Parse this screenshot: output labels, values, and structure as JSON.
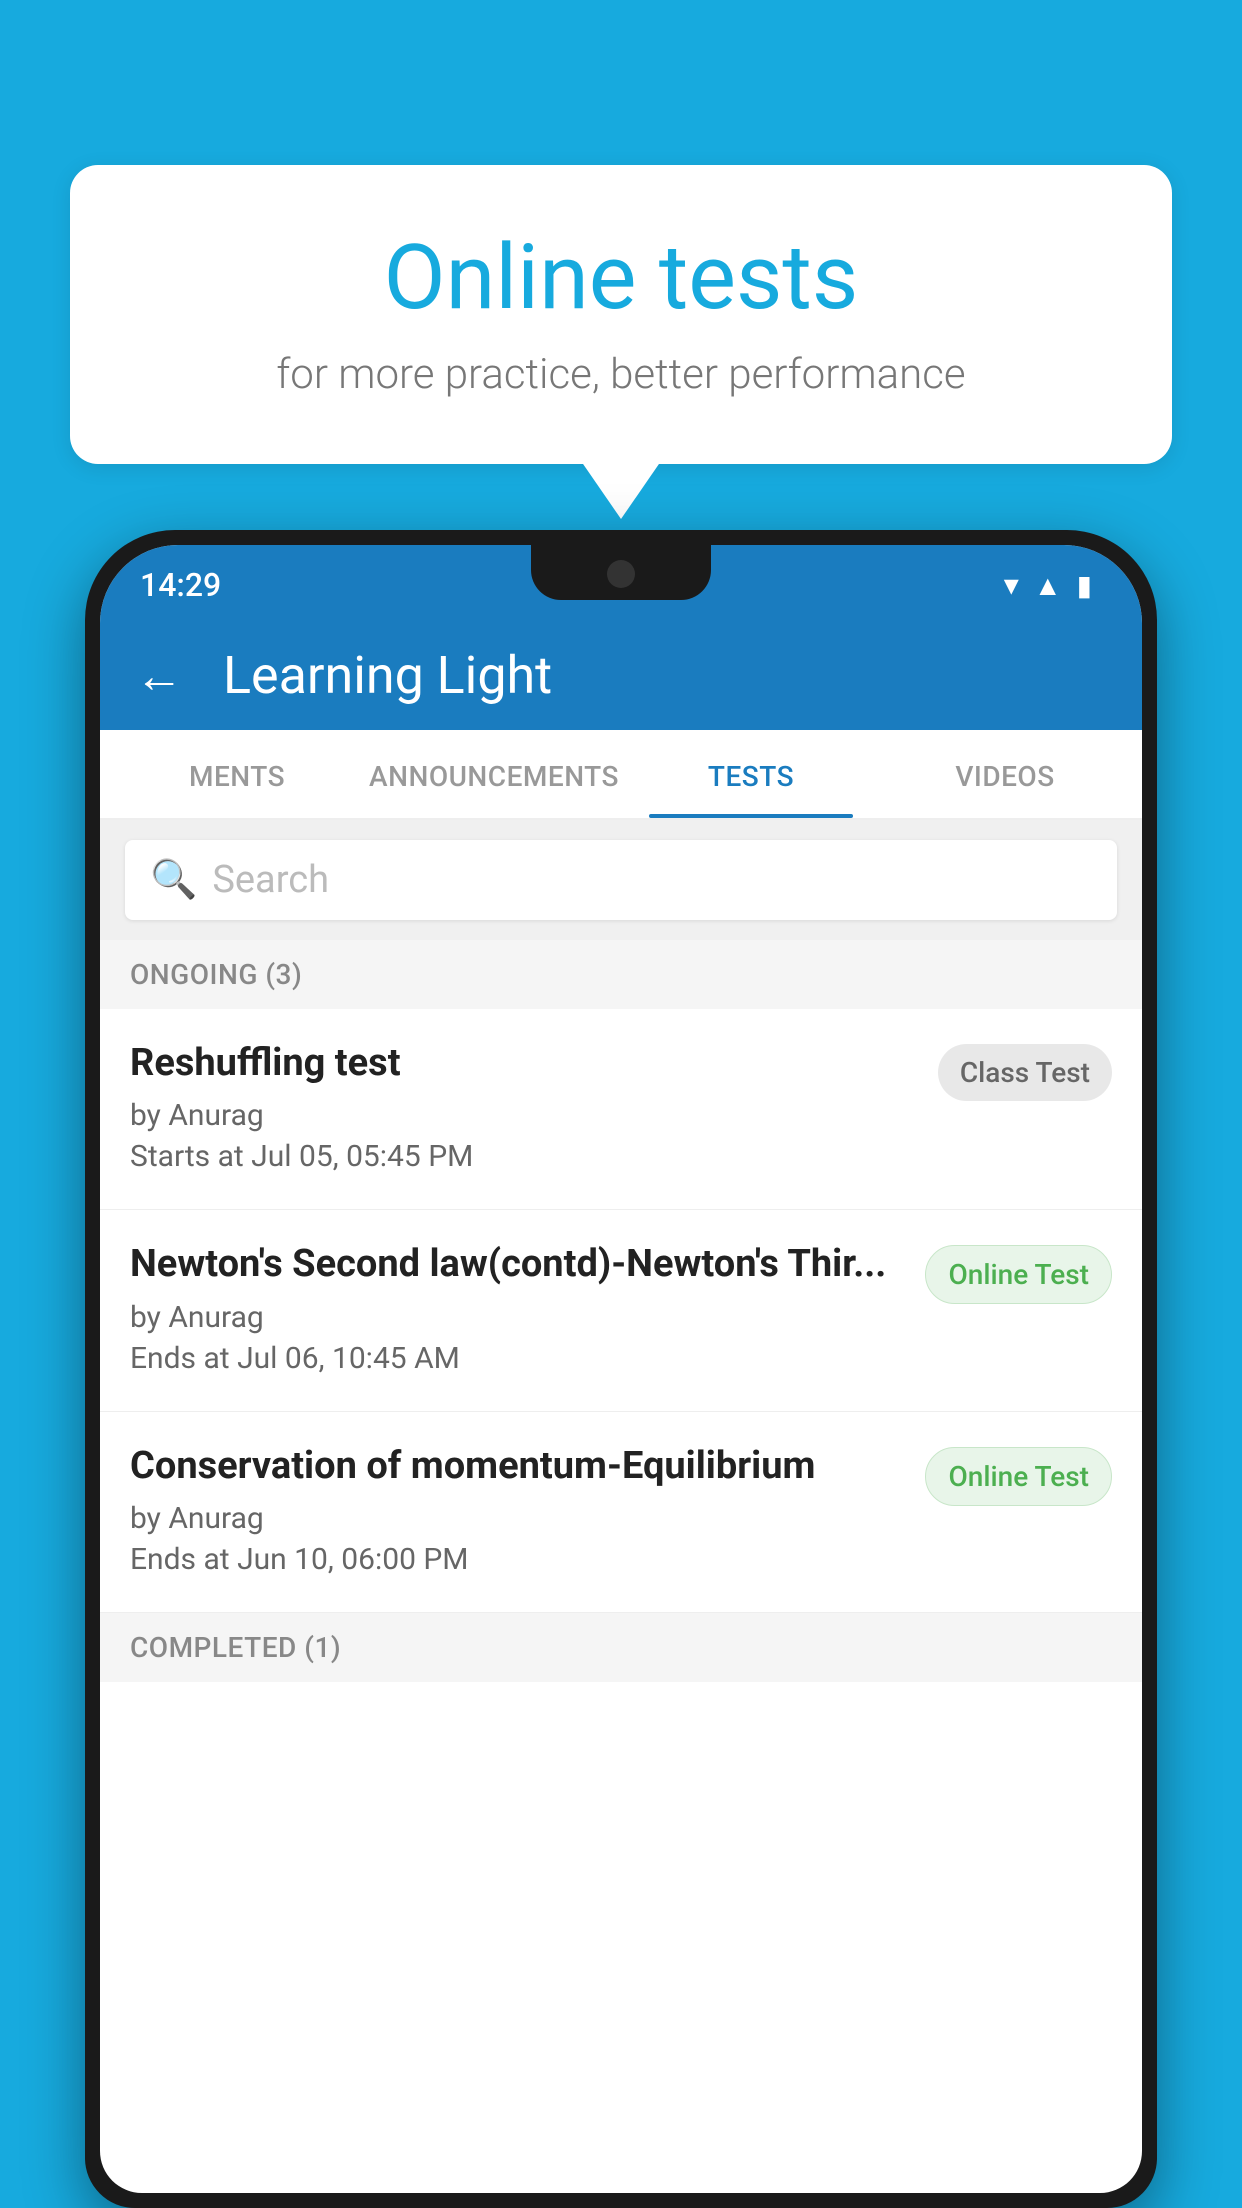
{
  "background": {
    "color": "#17AADE"
  },
  "speech_bubble": {
    "title": "Online tests",
    "subtitle": "for more practice, better performance"
  },
  "phone": {
    "status_bar": {
      "time": "14:29",
      "icons": [
        "wifi",
        "signal",
        "battery"
      ]
    },
    "app_bar": {
      "back_label": "←",
      "title": "Learning Light"
    },
    "tabs": [
      {
        "label": "MENTS",
        "active": false
      },
      {
        "label": "ANNOUNCEMENTS",
        "active": false
      },
      {
        "label": "TESTS",
        "active": true
      },
      {
        "label": "VIDEOS",
        "active": false
      }
    ],
    "search": {
      "placeholder": "Search"
    },
    "sections": [
      {
        "title": "ONGOING (3)",
        "items": [
          {
            "name": "Reshuffling test",
            "author": "by Anurag",
            "time_label": "Starts at",
            "time": "Jul 05, 05:45 PM",
            "badge": "Class Test",
            "badge_type": "class"
          },
          {
            "name": "Newton's Second law(contd)-Newton's Thir...",
            "author": "by Anurag",
            "time_label": "Ends at",
            "time": "Jul 06, 10:45 AM",
            "badge": "Online Test",
            "badge_type": "online"
          },
          {
            "name": "Conservation of momentum-Equilibrium",
            "author": "by Anurag",
            "time_label": "Ends at",
            "time": "Jun 10, 06:00 PM",
            "badge": "Online Test",
            "badge_type": "online"
          }
        ]
      }
    ],
    "completed_section": {
      "title": "COMPLETED (1)"
    }
  }
}
